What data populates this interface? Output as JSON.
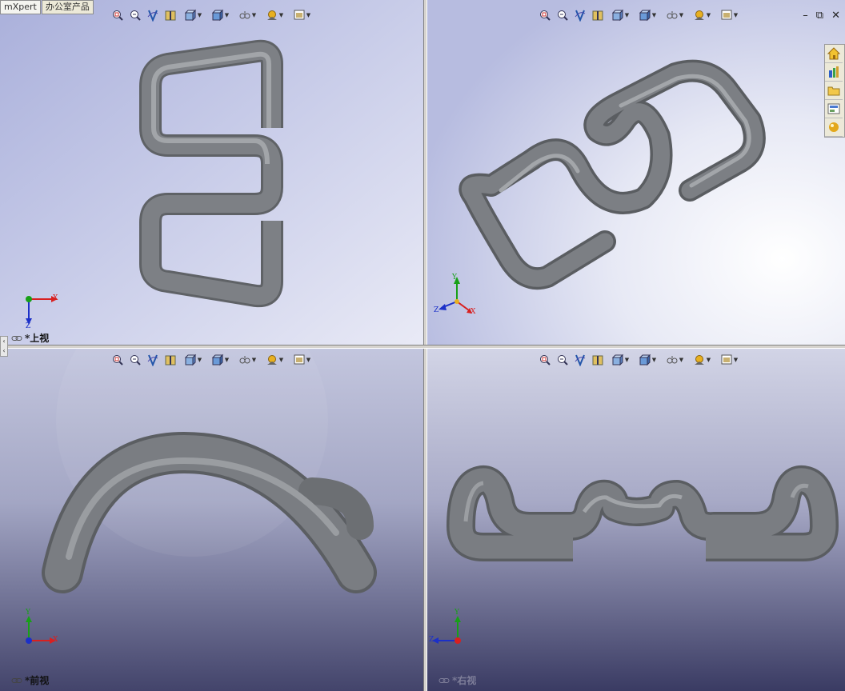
{
  "tabs": [
    {
      "label": "mXpert"
    },
    {
      "label": "办公室产品"
    }
  ],
  "viewports": {
    "top": {
      "label": "*上视",
      "axes": {
        "h": "X",
        "v": "Z"
      }
    },
    "iso": {
      "label": "",
      "axes": {
        "y": "Y",
        "z": "Z",
        "x": "X"
      }
    },
    "front": {
      "label": "*前视",
      "axes": {
        "h": "X",
        "v": "Y"
      }
    },
    "right": {
      "label": "*右视",
      "axes": {
        "h": "Z",
        "v": "Y"
      }
    }
  },
  "toolbar_icons": [
    "zoom-to-fit-icon",
    "zoom-to-area-icon",
    "previous-view-icon",
    "section-view-icon",
    "view-orientation-icon",
    "display-style-icon",
    "hide-show-items-icon",
    "edit-appearance-icon",
    "apply-scene-icon"
  ],
  "window_controls": [
    "minimize",
    "restore",
    "close"
  ],
  "task_pane": [
    "home-icon",
    "design-library-icon",
    "file-explorer-icon",
    "view-palette-icon",
    "appearances-icon"
  ],
  "colors": {
    "axis_x": "#d82020",
    "axis_y": "#18a018",
    "axis_z": "#1c30c8",
    "part": "#7b7e82"
  }
}
